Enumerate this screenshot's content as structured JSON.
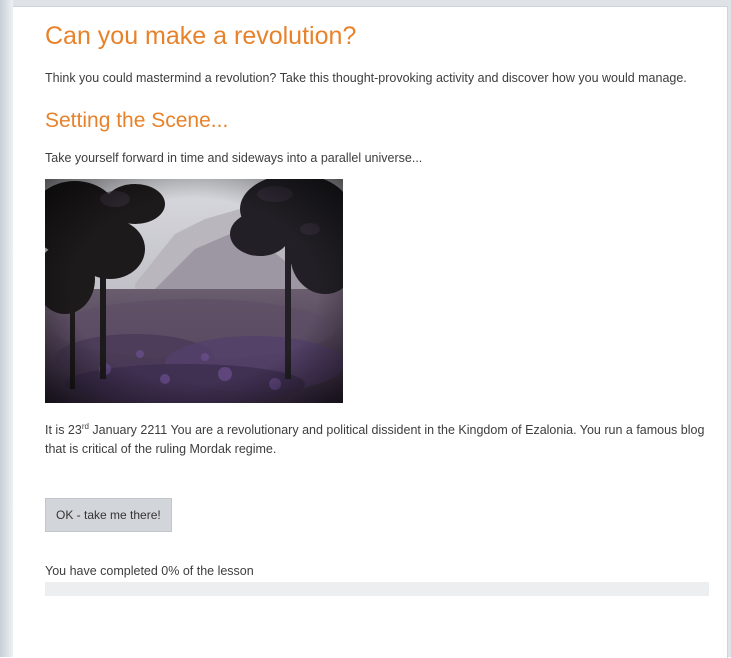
{
  "lesson": {
    "title": "Can you make a revolution?",
    "intro": "Think you could mastermind a revolution? Take this thought-provoking activity and discover how you would manage.",
    "section_title": "Setting the Scene...",
    "scene_text": "Take yourself forward in time and sideways into a parallel universe...",
    "story_prefix": "It is 23",
    "story_superscript": "rd",
    "story_suffix": " January 2211 You are a revolutionary and political dissident in  the Kingdom of Ezalonia. You run a famous blog that is critical of the ruling Mordak regime.",
    "button_label": "OK - take me there!",
    "progress_text": "You have completed 0% of the lesson",
    "progress_percent": 0
  },
  "image": {
    "subject": "forest-mountain-landscape"
  },
  "colors": {
    "heading": "#e8822a",
    "body_text": "#3d3d3d",
    "button_bg": "#d2d6da",
    "progress_track": "#eceef0"
  }
}
